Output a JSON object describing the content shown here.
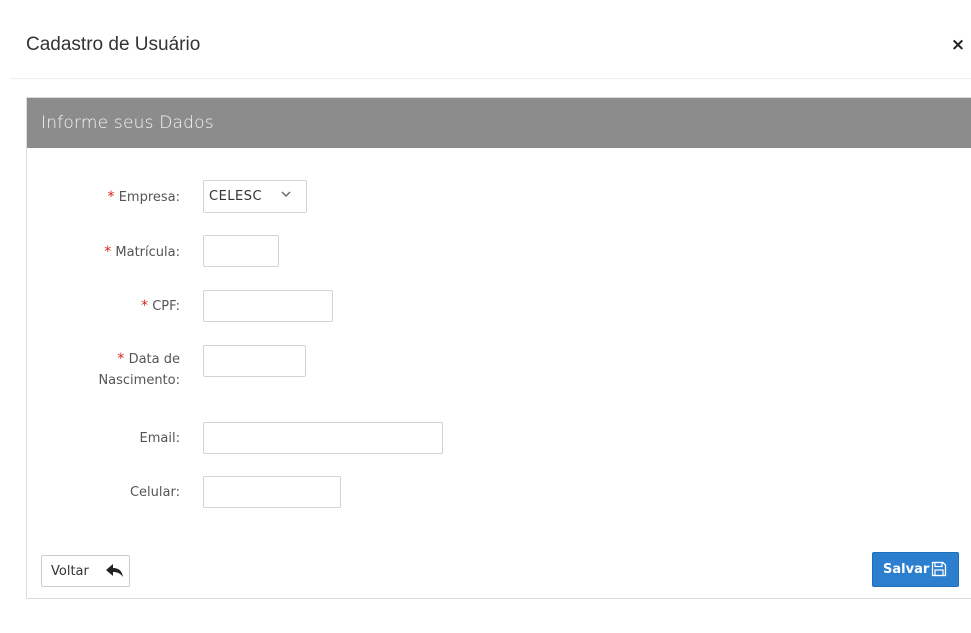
{
  "modal": {
    "title": "Cadastro de Usuário",
    "close_symbol": "×"
  },
  "panel": {
    "heading": "Informe seus Dados"
  },
  "form": {
    "required_marker": "*",
    "empresa": {
      "label": "Empresa:",
      "value": "CELESC",
      "required": true
    },
    "matricula": {
      "label": "Matrícula:",
      "value": "",
      "required": true
    },
    "cpf": {
      "label": "CPF:",
      "value": "",
      "required": true
    },
    "data_nascimento": {
      "label_line1": "Data de",
      "label_line2": "Nascimento:",
      "value": "",
      "required": true
    },
    "email": {
      "label": "Email:",
      "value": "",
      "required": false
    },
    "celular": {
      "label": "Celular:",
      "value": "",
      "required": false
    }
  },
  "actions": {
    "back_label": "Voltar",
    "back_icon": "reply-arrow-icon",
    "save_label": "Salvar",
    "save_icon": "floppy-disk-icon"
  },
  "colors": {
    "panel_heading_bg": "#8c8c8c",
    "required_marker": "#d9241c",
    "primary_button": "#2b7fce"
  }
}
